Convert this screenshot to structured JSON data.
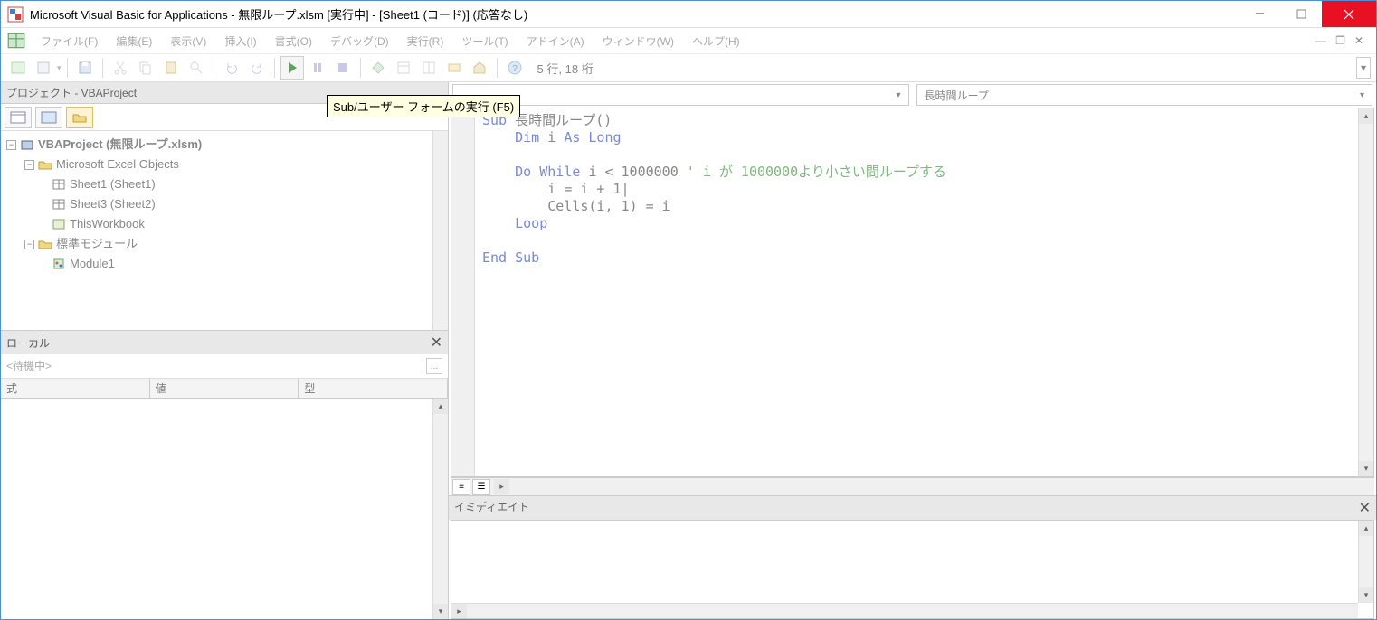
{
  "title": "Microsoft Visual Basic for Applications - 無限ループ.xlsm [実行中] - [Sheet1 (コード)] (応答なし)",
  "menus": {
    "file": "ファイル(F)",
    "edit": "編集(E)",
    "view": "表示(V)",
    "insert": "挿入(I)",
    "format": "書式(O)",
    "debug": "デバッグ(D)",
    "run": "実行(R)",
    "tools": "ツール(T)",
    "addins": "アドイン(A)",
    "window": "ウィンドウ(W)",
    "help": "ヘルプ(H)"
  },
  "cursor_pos": "5 行, 18 桁",
  "tooltip": "Sub/ユーザー フォームの実行 (F5)",
  "project": {
    "header": "プロジェクト - VBAProject",
    "root": "VBAProject (無限ループ.xlsm)",
    "excel_objects": "Microsoft Excel Objects",
    "sheet1": "Sheet1 (Sheet1)",
    "sheet3": "Sheet3 (Sheet2)",
    "thisworkbook": "ThisWorkbook",
    "modules": "標準モジュール",
    "module1": "Module1"
  },
  "locals": {
    "header": "ローカル",
    "waiting": "<待機中>",
    "col_expr": "式",
    "col_val": "値",
    "col_type": "型"
  },
  "proc_dropdown": "長時間ループ",
  "code": {
    "l1a": "Sub ",
    "l1b": "長時間ループ()",
    "l2a": "    Dim ",
    "l2b": "i ",
    "l2c": "As Long",
    "l3": "",
    "l4a": "    Do While ",
    "l4b": "i < 1000000 ",
    "l4c": "' i が 1000000より小さい間ループする",
    "l5": "        i = i + 1|",
    "l6": "        Cells(i, 1) = i",
    "l7a": "    Loop",
    "l8": "",
    "l9a": "End Sub"
  },
  "immediate": {
    "header": "イミディエイト"
  }
}
